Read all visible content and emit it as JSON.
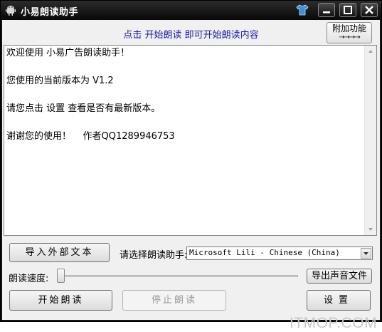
{
  "window": {
    "title": "小易朗读助手",
    "icons": {
      "app": "android-icon",
      "extra": "tshirt-icon",
      "minimize": "minimize-icon",
      "maximize": "maximize-icon",
      "close": "close-icon"
    }
  },
  "header": {
    "hint": "点击 开始朗读 即可开始朗读内容",
    "addon_label": "附加功能",
    "addon_arrows": "→→→→"
  },
  "content": {
    "lines": [
      "欢迎使用 小易广告朗读助手！",
      "您使用的当前版本为 V1.2",
      "请您点击 设置 查看是否有最新版本。",
      "谢谢您的使用！    作者QQ1289946753"
    ]
  },
  "controls": {
    "import_label": "导入外部文本",
    "voice_label": "请选择朗读助手:",
    "voice_value": "Microsoft Lili - Chinese (China)",
    "speed_label": "朗读速度:",
    "speed_value": 0,
    "export_label": "导出声音文件",
    "start_label": "开始朗读",
    "stop_label": "停止朗读",
    "settings_label": "设置"
  },
  "watermark": "ITMOP.COM"
}
